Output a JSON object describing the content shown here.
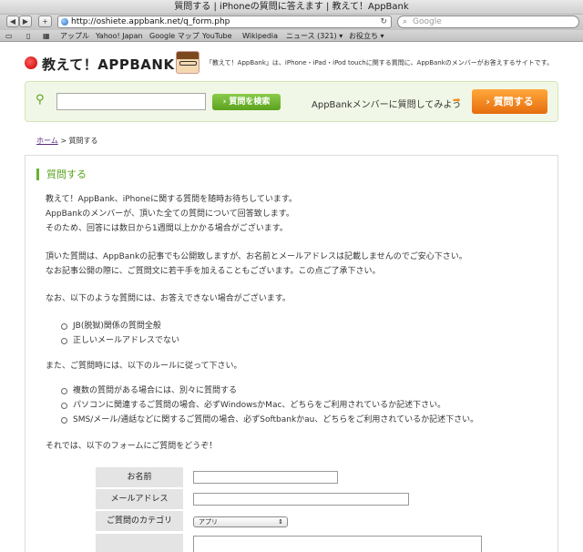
{
  "browser": {
    "title": "質問する | iPhoneの質問に答えます | 教えて！AppBank",
    "url": "http://oshiete.appbank.net/q_form.php",
    "search_placeholder": "Google",
    "bookmarks": [
      "アップル",
      "Yahoo! Japan",
      "Google マップ",
      "YouTube",
      "Wikipedia",
      "ニュース (321) ▾",
      "お役立ち ▾"
    ]
  },
  "header": {
    "logo": "教えて！APPBANK",
    "tagline": "「教えて！AppBank」は、iPhone・iPad・iPod touchに関する質問に、AppBankのメンバーがお答えするサイトです。"
  },
  "searchbar": {
    "button": "質問を検索",
    "prompt": "AppBankメンバーに質問してみよう",
    "ask_button": "質問する"
  },
  "breadcrumb": {
    "home": "ホーム",
    "sep": ">",
    "current": "質問する"
  },
  "main": {
    "title": "質問する",
    "intro": [
      "教えて！AppBank、iPhoneに関する質問を随時お待ちしています。",
      "AppBankのメンバーが、頂いた全ての質問について回答致します。",
      "そのため、回答には数日から1週間以上かかる場合がございます。"
    ],
    "privacy": [
      "頂いた質問は、AppBankの記事でも公開致しますが、お名前とメールアドレスは記載しませんのでご安心下さい。",
      "なお記事公開の際に、ご質問文に若干手を加えることもございます。この点ご了承下さい。"
    ],
    "no_answer_intro": "なお、以下のような質問には、お答えできない場合がございます。",
    "no_answer_list": [
      "JB(脱獄)関係の質問全般",
      "正しいメールアドレスでない"
    ],
    "rules_intro": "また、ご質問時には、以下のルールに従って下さい。",
    "rules_list": [
      "複数の質問がある場合には、別々に質問する",
      "パソコンに関連するご質問の場合、必ずWindowsかMac、どちらをご利用されているか記述下さい。",
      "SMS/メール/通話などに関するご質問の場合、必ずSoftbankかau、どちらをご利用されているか記述下さい。"
    ],
    "closing": "それでは、以下のフォームにご質問をどうぞ！"
  },
  "form": {
    "name_label": "お名前",
    "email_label": "メールアドレス",
    "category_label": "ご質問のカテゴリ",
    "category_value": "アプリ"
  }
}
